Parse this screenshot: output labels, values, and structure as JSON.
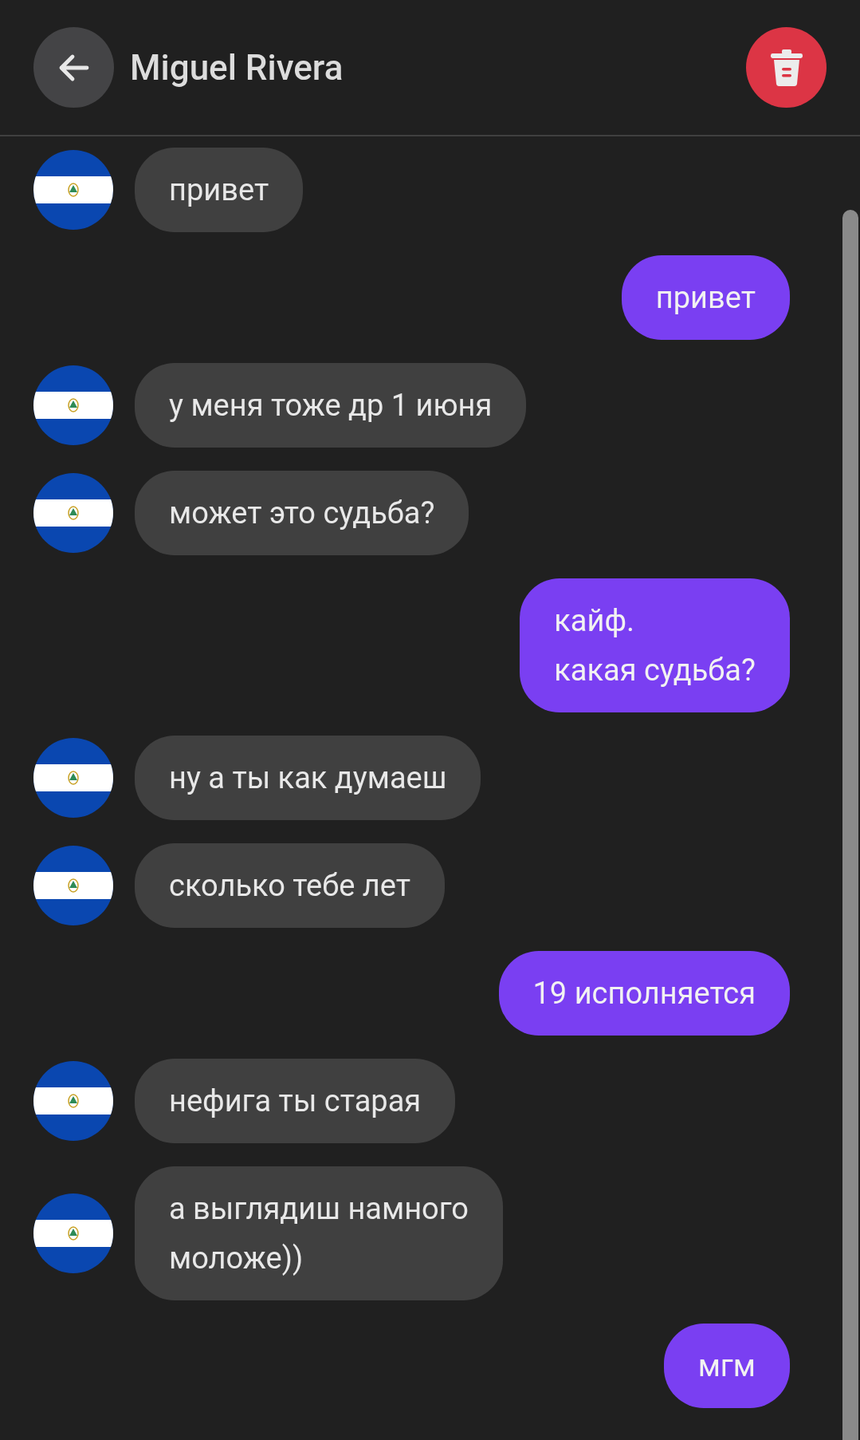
{
  "header": {
    "title": "Miguel Rivera"
  },
  "messages": [
    {
      "kind": "incoming",
      "text": "привет"
    },
    {
      "kind": "outgoing",
      "text": "привет"
    },
    {
      "kind": "incoming",
      "text": "у меня тоже др 1 июня"
    },
    {
      "kind": "incoming",
      "text": "может это судьба?"
    },
    {
      "kind": "outgoing",
      "text": "кайф.\nкакая судьба?"
    },
    {
      "kind": "incoming",
      "text": "ну а ты как думаеш"
    },
    {
      "kind": "incoming",
      "text": "сколько тебе лет"
    },
    {
      "kind": "outgoing",
      "text": "19 исполняется"
    },
    {
      "kind": "incoming",
      "text": "нефига ты старая"
    },
    {
      "kind": "incoming",
      "text": "а выглядиш намного\nмоложе))"
    },
    {
      "kind": "outgoing",
      "text": "мгм"
    }
  ]
}
